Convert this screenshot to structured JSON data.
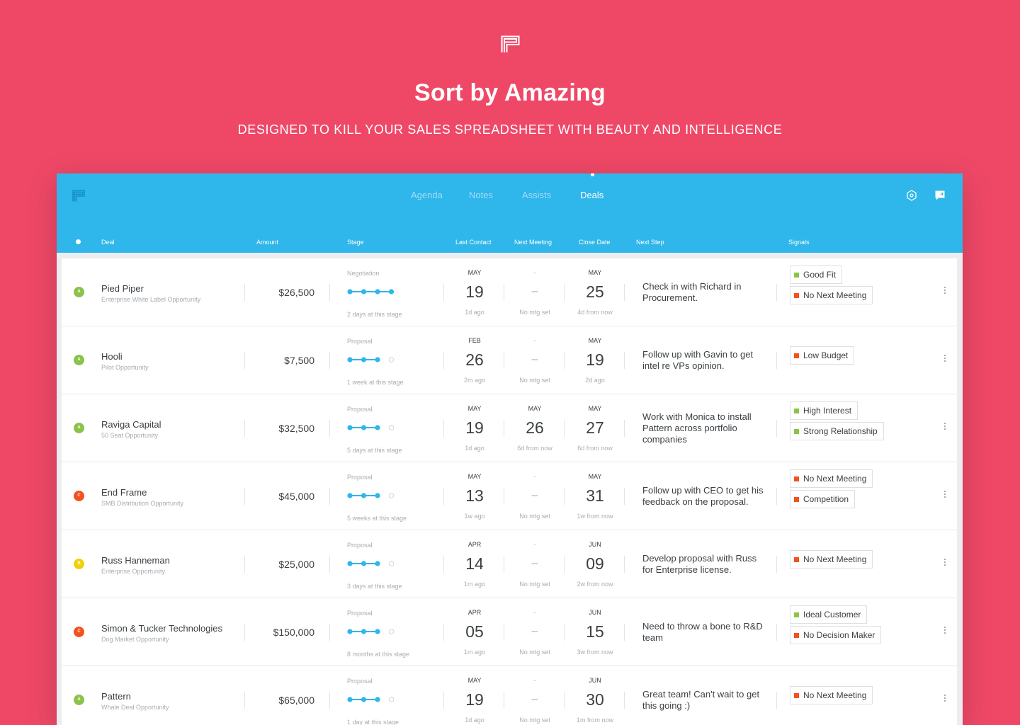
{
  "hero": {
    "title": "Sort by Amazing",
    "subtitle": "DESIGNED TO KILL YOUR SALES SPREADSHEET WITH BEAUTY AND INTELLIGENCE"
  },
  "colors": {
    "background": "#ef4867",
    "topbar": "#2fb6ea",
    "stage_dot": "#2fb6ea",
    "grade_a": "#8bc34a",
    "grade_b": "#f1d00b",
    "grade_c": "#f4511e",
    "signal_positive": "#8bc34a",
    "signal_negative": "#f4511e"
  },
  "nav": {
    "agenda": "Agenda",
    "notes": "Notes",
    "assists": "Assists",
    "deals": "Deals",
    "active": "Deals"
  },
  "icons": {
    "hero_logo": "pattern-logo-icon",
    "app_logo": "pattern-logo-icon",
    "settings": "hexagon-settings-icon",
    "feedback": "chat-bubble-icon",
    "row_menu": "vertical-dots-icon"
  },
  "columns": {
    "deal": "Deal",
    "amount": "Amount",
    "stage": "Stage",
    "last_contact": "Last Contact",
    "next_meeting": "Next Meeting",
    "close_date": "Close Date",
    "next_step": "Next Step",
    "signals": "Signals"
  },
  "deals": [
    {
      "grade": "A",
      "grade_color": "#8bc34a",
      "name": "Pied Piper",
      "sub": "Enterprise White Label Opportunity",
      "amount": "$26,500",
      "stage": "Negotiation",
      "stage_step": 4,
      "stage_total": 4,
      "stage_time": "2 days at this stage",
      "last": {
        "mon": "MAY",
        "day": "19",
        "sub": "1d ago"
      },
      "meeting": {
        "mon": "-",
        "day": "–",
        "sub": "No mtg set"
      },
      "close": {
        "mon": "MAY",
        "day": "25",
        "sub": "4d from now"
      },
      "next_step": "Check in with Richard in Procurement.",
      "signals": [
        {
          "label": "Good Fit",
          "color": "#8bc34a"
        },
        {
          "label": "No Next Meeting",
          "color": "#f4511e"
        }
      ]
    },
    {
      "grade": "A",
      "grade_color": "#8bc34a",
      "name": "Hooli",
      "sub": "Pilot Opportunity",
      "amount": "$7,500",
      "stage": "Proposal",
      "stage_step": 3,
      "stage_total": 4,
      "stage_time": "1 week at this stage",
      "last": {
        "mon": "FEB",
        "day": "26",
        "sub": "2m ago"
      },
      "meeting": {
        "mon": "-",
        "day": "–",
        "sub": "No mtg set"
      },
      "close": {
        "mon": "MAY",
        "day": "19",
        "sub": "2d ago"
      },
      "next_step": "Follow up with Gavin to get intel re VPs opinion.",
      "signals": [
        {
          "label": "Low Budget",
          "color": "#f4511e"
        }
      ]
    },
    {
      "grade": "A",
      "grade_color": "#8bc34a",
      "name": "Raviga Capital",
      "sub": "50 Seat Opportunity",
      "amount": "$32,500",
      "stage": "Proposal",
      "stage_step": 3,
      "stage_total": 4,
      "stage_time": "5 days at this stage",
      "last": {
        "mon": "MAY",
        "day": "19",
        "sub": "1d ago"
      },
      "meeting": {
        "mon": "MAY",
        "day": "26",
        "sub": "6d from now"
      },
      "close": {
        "mon": "MAY",
        "day": "27",
        "sub": "6d from now"
      },
      "next_step": "Work with Monica to install Pattern across portfolio companies",
      "signals": [
        {
          "label": "High Interest",
          "color": "#8bc34a"
        },
        {
          "label": "Strong Relationship",
          "color": "#8bc34a"
        }
      ]
    },
    {
      "grade": "C",
      "grade_color": "#f4511e",
      "name": "End Frame",
      "sub": "SMB Distribution Opportunity",
      "amount": "$45,000",
      "stage": "Proposal",
      "stage_step": 3,
      "stage_total": 4,
      "stage_time": "5 weeks at this stage",
      "last": {
        "mon": "MAY",
        "day": "13",
        "sub": "1w ago"
      },
      "meeting": {
        "mon": "-",
        "day": "–",
        "sub": "No mtg set"
      },
      "close": {
        "mon": "MAY",
        "day": "31",
        "sub": "1w from now"
      },
      "next_step": "Follow up with CEO to get his feedback on the proposal.",
      "signals": [
        {
          "label": "No Next Meeting",
          "color": "#f4511e"
        },
        {
          "label": "Competition",
          "color": "#f4511e"
        }
      ]
    },
    {
      "grade": "B",
      "grade_color": "#f1d00b",
      "name": "Russ Hanneman",
      "sub": "Enterprise Opportunity",
      "amount": "$25,000",
      "stage": "Proposal",
      "stage_step": 3,
      "stage_total": 4,
      "stage_time": "3 days at this stage",
      "last": {
        "mon": "APR",
        "day": "14",
        "sub": "1m ago"
      },
      "meeting": {
        "mon": "-",
        "day": "–",
        "sub": "No mtg set"
      },
      "close": {
        "mon": "JUN",
        "day": "09",
        "sub": "2w from now"
      },
      "next_step": "Develop proposal with Russ for Enterprise license.",
      "signals": [
        {
          "label": "No Next Meeting",
          "color": "#f4511e"
        }
      ]
    },
    {
      "grade": "C",
      "grade_color": "#f4511e",
      "name": "Simon & Tucker Technologies",
      "sub": "Dog Market Opportunity",
      "amount": "$150,000",
      "stage": "Proposal",
      "stage_step": 3,
      "stage_total": 4,
      "stage_time": "8 months at this stage",
      "last": {
        "mon": "APR",
        "day": "05",
        "sub": "1m ago"
      },
      "meeting": {
        "mon": "-",
        "day": "–",
        "sub": "No mtg set"
      },
      "close": {
        "mon": "JUN",
        "day": "15",
        "sub": "3w from now"
      },
      "next_step": "Need to throw a bone to R&D team",
      "signals": [
        {
          "label": "Ideal Customer",
          "color": "#8bc34a"
        },
        {
          "label": "No Decision Maker",
          "color": "#f4511e"
        }
      ]
    },
    {
      "grade": "A",
      "grade_color": "#8bc34a",
      "name": "Pattern",
      "sub": "Whale Deal Opportunity",
      "amount": "$65,000",
      "stage": "Proposal",
      "stage_step": 3,
      "stage_total": 4,
      "stage_time": "1 day at this stage",
      "last": {
        "mon": "MAY",
        "day": "19",
        "sub": "1d ago"
      },
      "meeting": {
        "mon": "-",
        "day": "–",
        "sub": "No mtg set"
      },
      "close": {
        "mon": "JUN",
        "day": "30",
        "sub": "1m from now"
      },
      "next_step": "Great team! Can't wait to get this going :)",
      "signals": [
        {
          "label": "No Next Meeting",
          "color": "#f4511e"
        }
      ]
    }
  ]
}
